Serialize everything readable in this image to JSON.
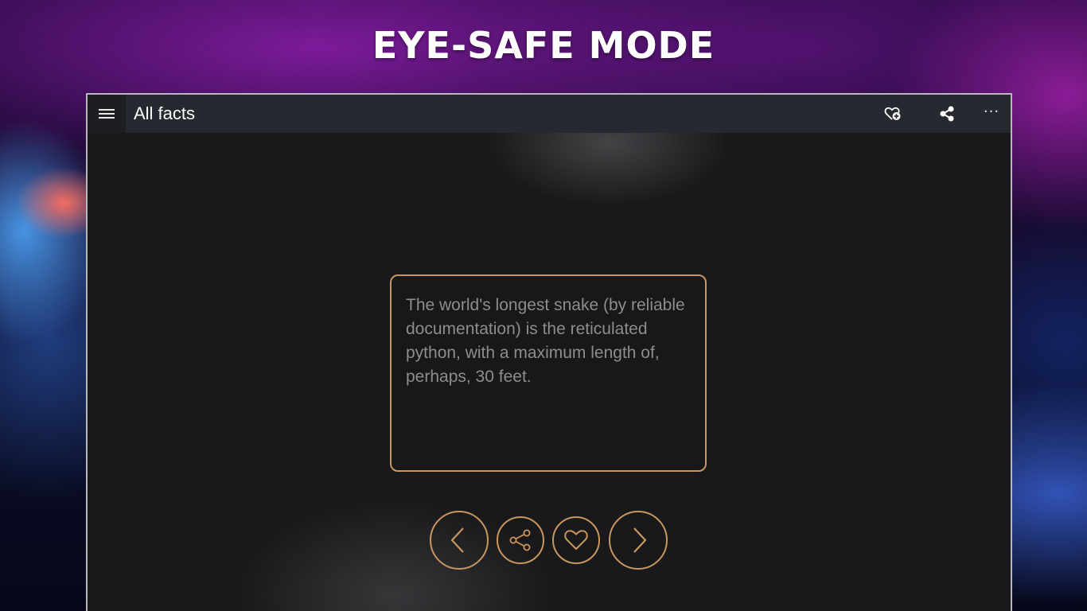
{
  "promo": {
    "title": "EYE-SAFE MODE"
  },
  "app": {
    "page_title": "All facts",
    "toolbar": {
      "menu_icon": "hamburger-menu-icon",
      "add_favorite_icon": "heart-plus-icon",
      "share_icon": "share-icon",
      "more_label": "···"
    },
    "fact": {
      "text": "The world's longest snake (by reliable documentation) is the reticulated python, with a maximum length of, perhaps, 30 feet."
    },
    "controls": {
      "previous_icon": "chevron-left-icon",
      "share_icon": "share-icon",
      "favorite_icon": "heart-icon",
      "next_icon": "chevron-right-icon"
    }
  },
  "colors": {
    "accent": "#c8965e",
    "topbar": "#26292f",
    "content_bg": "#19191b",
    "fact_text": "#8d8d8f"
  }
}
